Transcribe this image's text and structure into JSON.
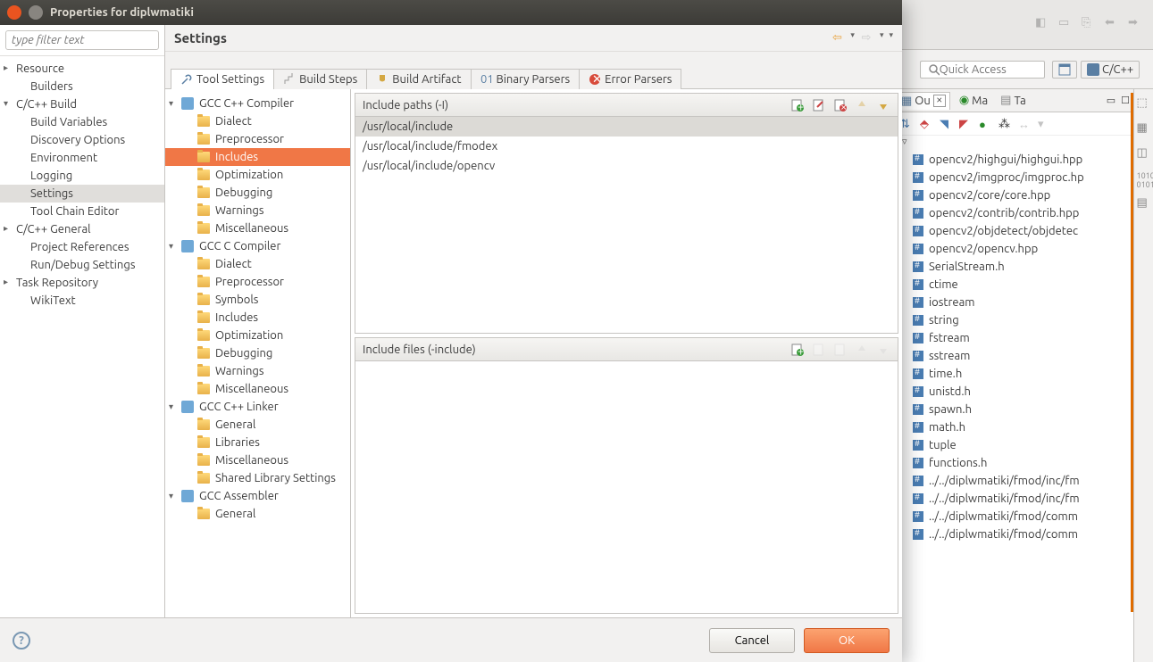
{
  "eclipse": {
    "quick_access_placeholder": "Quick Access",
    "perspective_label": "C/C++",
    "outline_tabs": {
      "ou": "Ou",
      "ma": "Ma",
      "ta": "Ta"
    },
    "outline_items": [
      "opencv2/highgui/highgui.hpp",
      "opencv2/imgproc/imgproc.hp",
      "opencv2/core/core.hpp",
      "opencv2/contrib/contrib.hpp",
      "opencv2/objdetect/objdetec",
      "opencv2/opencv.hpp",
      "SerialStream.h",
      "ctime",
      "iostream",
      "string",
      "fstream",
      "sstream",
      "time.h",
      "unistd.h",
      "spawn.h",
      "math.h",
      "tuple",
      "functions.h",
      "../../diplwmatiki/fmod/inc/fm",
      "../../diplwmatiki/fmod/inc/fm",
      "../../diplwmatiki/fmod/comm",
      "../../diplwmatiki/fmod/comm"
    ]
  },
  "dialog": {
    "title": "Properties for diplwmatiki",
    "filter_placeholder": "type filter text",
    "nav": {
      "resource": "Resource",
      "builders": "Builders",
      "ccbuild": "C/C++ Build",
      "build_variables": "Build Variables",
      "discovery": "Discovery Options",
      "environment": "Environment",
      "logging": "Logging",
      "settings": "Settings",
      "toolchain": "Tool Chain Editor",
      "ccgeneral": "C/C++ General",
      "projrefs": "Project References",
      "rundebug": "Run/Debug Settings",
      "taskrepo": "Task Repository",
      "wikitext": "WikiText"
    },
    "heading": "Settings",
    "tabs": {
      "tool_settings": "Tool Settings",
      "build_steps": "Build Steps",
      "build_artifact": "Build Artifact",
      "binary_parsers": "Binary Parsers",
      "error_parsers": "Error Parsers"
    },
    "tool_tree": {
      "gcc_cpp_compiler": "GCC C++ Compiler",
      "dialect": "Dialect",
      "preprocessor": "Preprocessor",
      "includes": "Includes",
      "optimization": "Optimization",
      "debugging": "Debugging",
      "warnings": "Warnings",
      "misc": "Miscellaneous",
      "gcc_c_compiler": "GCC C Compiler",
      "symbols": "Symbols",
      "gcc_cpp_linker": "GCC C++ Linker",
      "general": "General",
      "libraries": "Libraries",
      "shared_lib": "Shared Library Settings",
      "gcc_assembler": "GCC Assembler"
    },
    "include_paths_label": "Include paths (-I)",
    "include_paths": [
      "/usr/local/include",
      "/usr/local/include/fmodex",
      "/usr/local/include/opencv"
    ],
    "include_files_label": "Include files (-include)",
    "buttons": {
      "cancel": "Cancel",
      "ok": "OK"
    }
  }
}
